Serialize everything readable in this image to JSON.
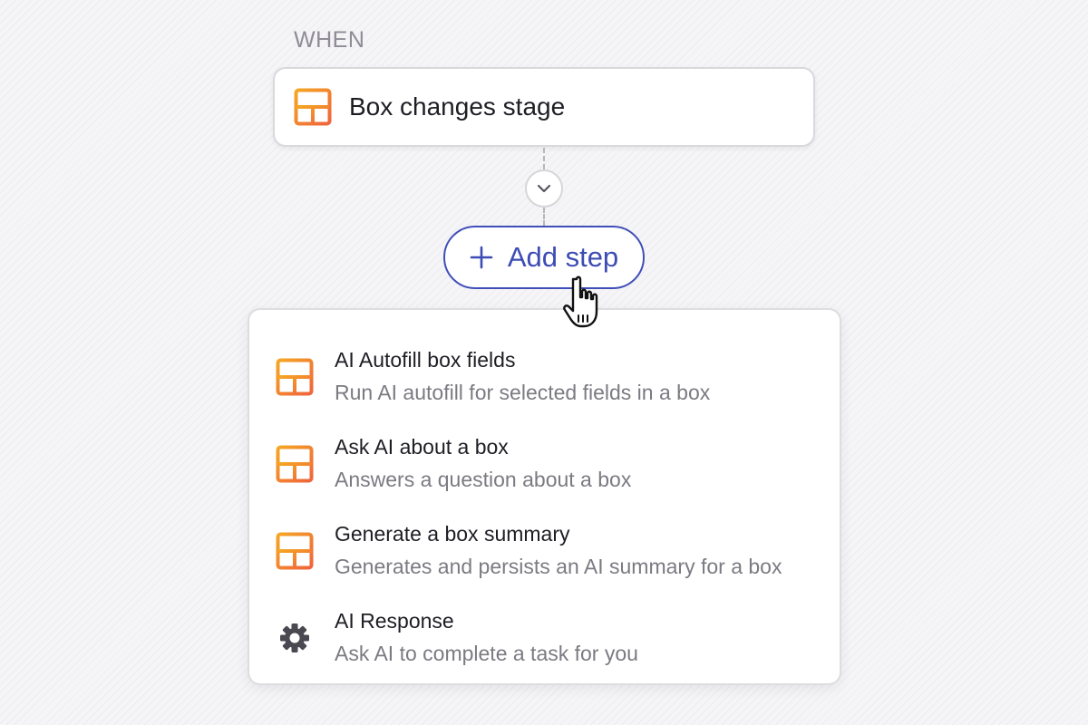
{
  "trigger": {
    "section_label": "WHEN",
    "title": "Box changes stage",
    "icon": "box-layout-icon"
  },
  "connector": {
    "toggle_icon": "chevron-down-icon"
  },
  "add_step": {
    "label": "Add step",
    "icon": "plus-icon"
  },
  "menu": {
    "items": [
      {
        "title": "AI Autofill box fields",
        "description": "Run AI autofill for selected fields in a box",
        "icon": "box-layout-icon"
      },
      {
        "title": "Ask AI about a box",
        "description": "Answers a question about a box",
        "icon": "box-layout-icon"
      },
      {
        "title": "Generate a box summary",
        "description": "Generates and persists an AI summary for a box",
        "icon": "box-layout-icon"
      },
      {
        "title": "AI Response",
        "description": "Ask AI to complete a task for you",
        "icon": "gear-icon"
      }
    ]
  },
  "colors": {
    "accent": "#3e4fb8",
    "icon_gradient_start": "#f5a623",
    "icon_gradient_end": "#f0643c",
    "text_primary": "#1f1d24",
    "text_secondary": "#7c7a82",
    "section_label": "#8f8c96"
  },
  "pointer": {
    "icon": "hand-pointer-icon"
  }
}
